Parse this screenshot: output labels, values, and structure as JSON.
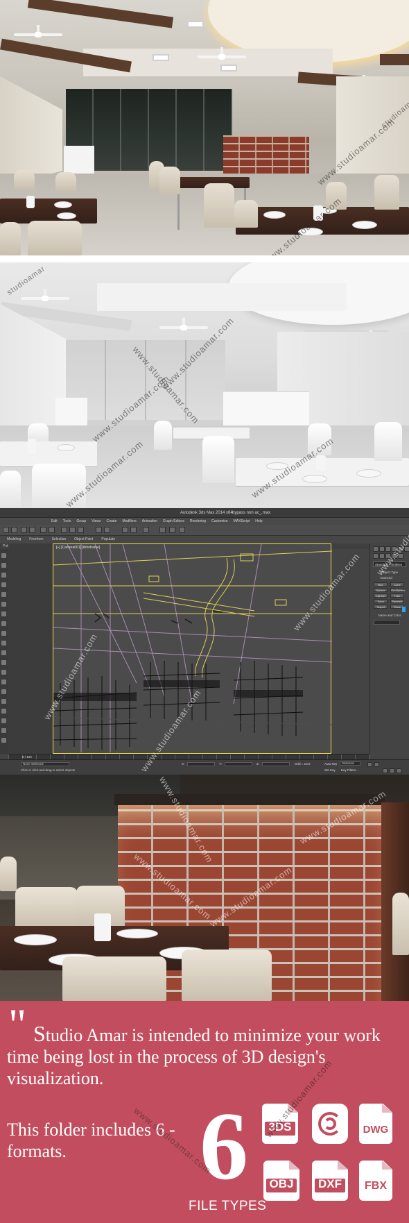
{
  "watermark": "www.studioamar.com",
  "watermark_short": "studioamar",
  "max_window": {
    "title": "Autodesk 3ds Max 2014 x64",
    "file": "bypass non ac_.max",
    "menus": [
      "Edit",
      "Tools",
      "Group",
      "Views",
      "Create",
      "Modifiers",
      "Animation",
      "Graph Editors",
      "Rendering",
      "Customize",
      "MAXScript",
      "Help"
    ],
    "ribbon_tabs": [
      "Modeling",
      "Freeform",
      "Selection",
      "Object Paint",
      "Populate"
    ],
    "ribbon_sub": "Polygon Modeling",
    "viewport_label": "[+] [Camera001] [Wireframe]",
    "command_panel": {
      "dropdown": "Standard Primitives",
      "section": "Object Type",
      "autogrid": "AutoGrid",
      "buttons": [
        [
          "Box",
          "Cone"
        ],
        [
          "Sphere",
          "GeoSphere"
        ],
        [
          "Cylinder",
          "Tube"
        ],
        [
          "Torus",
          "Pyramid"
        ],
        [
          "Teapot",
          "Plane"
        ]
      ],
      "name_section": "Name and Color"
    },
    "time_slider": "0 / 100",
    "status": {
      "selected": "None Selected",
      "prompt": "Click or click-and-drag to select objects",
      "x_label": "X:",
      "y_label": "Y:",
      "z_label": "Z:",
      "grid": "Grid = 10.0",
      "auto_key": "Auto Key",
      "selected_dd": "Selected",
      "set_key": "Set Key",
      "key_filters": "Key Filters..."
    }
  },
  "promo": {
    "quote": "\"",
    "first_letter": "S",
    "paragraph_rest": "tudio Amar is intended to minimize your work time being lost in the process of 3D design's visualization.",
    "folder_line": "This folder includes 6 - formats.",
    "count": "6",
    "file_types_label": "FILE TYPES",
    "formats": [
      "3DS",
      "",
      "DWG",
      "OBJ",
      "DXF",
      "FBX"
    ],
    "colors": {
      "background": "#c24d5e",
      "text": "#ffffff"
    }
  }
}
